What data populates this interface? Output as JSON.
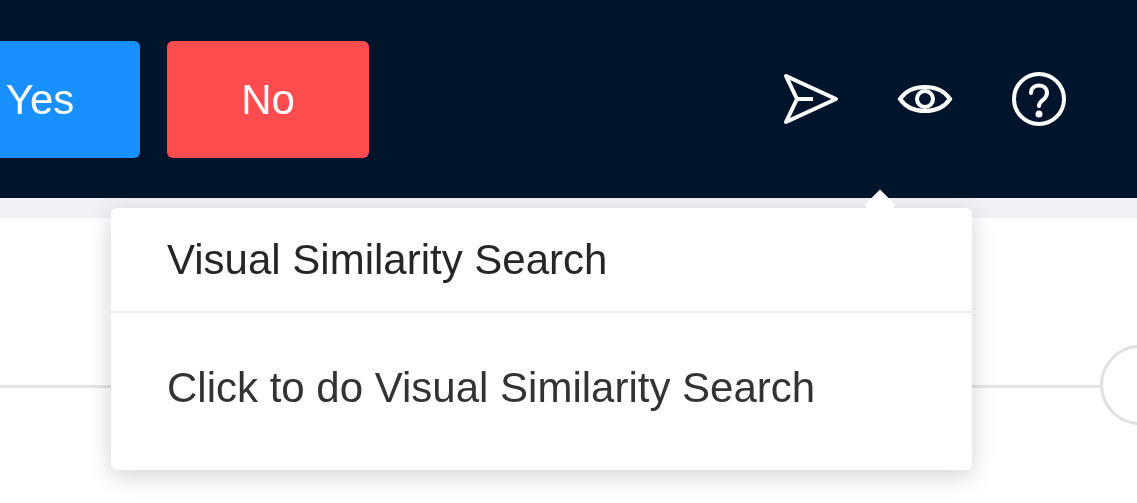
{
  "header": {
    "buttons": [
      {
        "label": "Yes",
        "kind": "primary"
      },
      {
        "label": "No",
        "kind": "danger"
      }
    ]
  },
  "popover": {
    "title": "Visual Similarity Search",
    "content": "Click to do Visual Similarity Search"
  }
}
